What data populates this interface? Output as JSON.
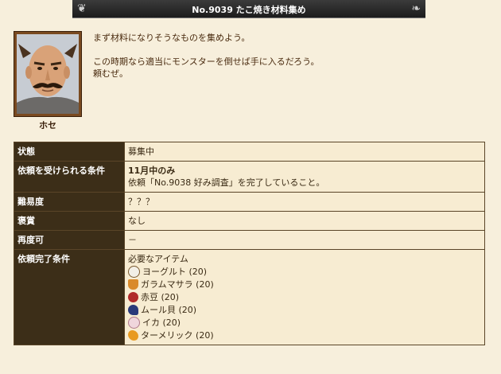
{
  "quest": {
    "title": "No.9039 たこ焼き材料集め"
  },
  "npc": {
    "name": "ホセ"
  },
  "dialog": [
    "まず材料になりそうなものを集めよう。",
    "",
    "この時期なら適当にモンスターを倒せば手に入るだろう。",
    "頼むぜ。"
  ],
  "rows": {
    "status": {
      "label": "状態",
      "value": "募集中"
    },
    "condition": {
      "label": "依頼を受けられる条件",
      "line1": "11月中のみ",
      "line2": "依頼「No.9038 好み調査」を完了していること。"
    },
    "difficulty": {
      "label": "難易度",
      "value": "？？？"
    },
    "reward": {
      "label": "褒賞",
      "value": "なし"
    },
    "repeat": {
      "label": "再度可",
      "value": "－"
    },
    "completion": {
      "label": "依頼完了条件",
      "heading": "必要なアイテム",
      "items": [
        {
          "name": "ヨーグルト (20)",
          "icon": "yogurt-icon",
          "color": "#f2efe6"
        },
        {
          "name": "ガラムマサラ (20)",
          "icon": "garam-masala-icon",
          "color": "#d98a2a"
        },
        {
          "name": "赤豆 (20)",
          "icon": "red-bean-icon",
          "color": "#b02a2a"
        },
        {
          "name": "ムール貝 (20)",
          "icon": "mussel-icon",
          "color": "#2a3a7a"
        },
        {
          "name": "イカ (20)",
          "icon": "squid-icon",
          "color": "#f0d6dc"
        },
        {
          "name": "ターメリック (20)",
          "icon": "turmeric-icon",
          "color": "#e89a20"
        }
      ]
    }
  }
}
